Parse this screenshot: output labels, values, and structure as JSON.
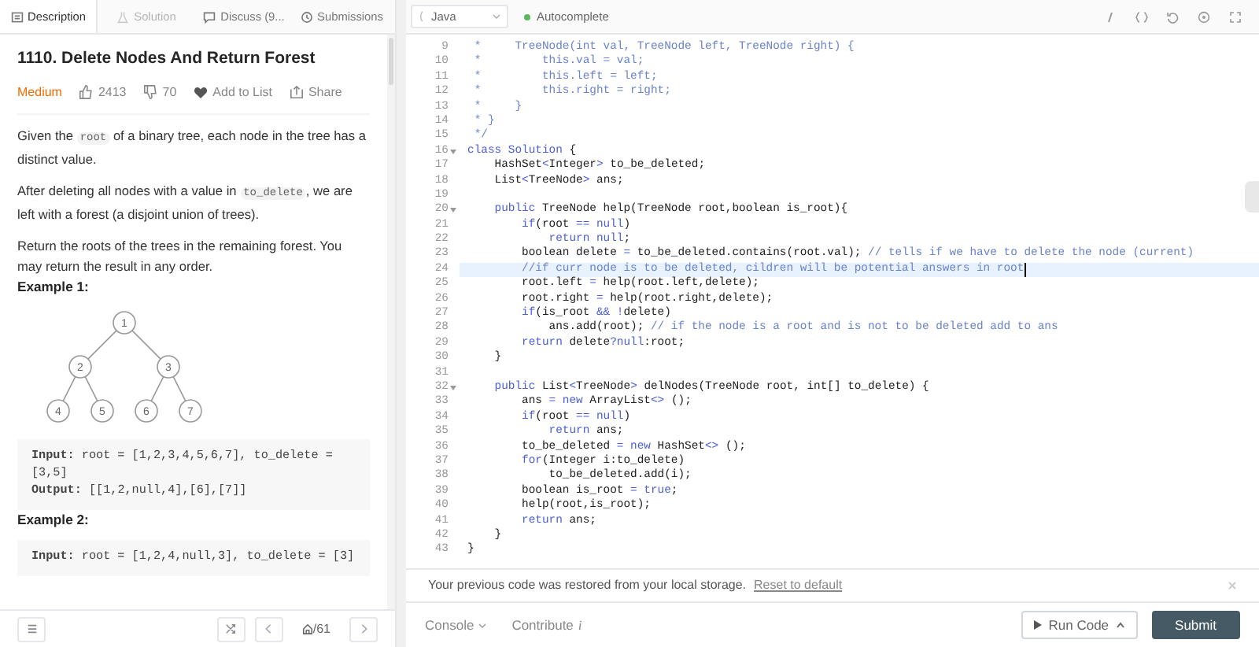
{
  "description_tabs": [
    {
      "label": "Description",
      "selected": true,
      "disabled": false
    },
    {
      "label": "Solution",
      "selected": false,
      "disabled": true
    },
    {
      "label": "Discuss (9...",
      "selected": false,
      "disabled": false
    },
    {
      "label": "Submissions",
      "selected": false,
      "disabled": false
    }
  ],
  "problem": {
    "title": "1110. Delete Nodes And Return Forest",
    "difficulty": "Medium",
    "likes": "2413",
    "dislikes": "70",
    "add_to_list": "Add to List",
    "share": "Share",
    "paragraphs": [
      [
        {
          "text": "Given the ",
          "code": false
        },
        {
          "text": "root",
          "code": true
        },
        {
          "text": " of a binary tree, each node in the tree has a distinct value.",
          "code": false
        }
      ],
      [
        {
          "text": "After deleting all nodes with a value in ",
          "code": false
        },
        {
          "text": "to_delete",
          "code": true
        },
        {
          "text": ", we are left with a forest (a disjoint union of trees).",
          "code": false
        }
      ],
      [
        {
          "text": "Return the roots of the trees in the remaining forest. You may return the result in any order.",
          "code": false
        }
      ]
    ],
    "examples": [
      {
        "title": "Example 1:",
        "tree": {
          "label": "1",
          "children": [
            {
              "label": "2",
              "children": [
                {
                  "label": "4"
                },
                {
                  "label": "5"
                }
              ]
            },
            {
              "label": "3",
              "children": [
                {
                  "label": "6"
                },
                {
                  "label": "7"
                }
              ]
            }
          ]
        },
        "lines": [
          {
            "label": "Input:",
            "text": " root = [1,2,3,4,5,6,7], to_delete = [3,5]"
          },
          {
            "label": "Output:",
            "text": " [[1,2,null,4],[6],[7]]"
          }
        ]
      },
      {
        "title": "Example 2:",
        "lines": [
          {
            "label": "Input:",
            "text": " root = [1,2,4,null,3], to_delete = [3]"
          }
        ]
      }
    ]
  },
  "left_footer": {
    "pager": "/61"
  },
  "editor_toolbar": {
    "language": "Java",
    "autocomplete": {
      "label": "Autocomplete",
      "on": true
    }
  },
  "code_lines": [
    {
      "no": "9",
      "highlighted": false,
      "foldable": false,
      "segments": [
        {
          "kind": "comment",
          "text": " *     TreeNode(int val, TreeNode left, TreeNode right) {"
        }
      ]
    },
    {
      "no": "10",
      "highlighted": false,
      "foldable": false,
      "segments": [
        {
          "kind": "comment",
          "text": " *         this.val = val;"
        }
      ]
    },
    {
      "no": "11",
      "highlighted": false,
      "foldable": false,
      "segments": [
        {
          "kind": "comment",
          "text": " *         this.left = left;"
        }
      ]
    },
    {
      "no": "12",
      "highlighted": false,
      "foldable": false,
      "segments": [
        {
          "kind": "comment",
          "text": " *         this.right = right;"
        }
      ]
    },
    {
      "no": "13",
      "highlighted": false,
      "foldable": false,
      "segments": [
        {
          "kind": "comment",
          "text": " *     }"
        }
      ]
    },
    {
      "no": "14",
      "highlighted": false,
      "foldable": false,
      "segments": [
        {
          "kind": "comment",
          "text": " * }"
        }
      ]
    },
    {
      "no": "15",
      "highlighted": false,
      "foldable": false,
      "segments": [
        {
          "kind": "comment",
          "text": " */"
        }
      ]
    },
    {
      "no": "16",
      "highlighted": false,
      "foldable": true,
      "segments": [
        {
          "kind": "keyword",
          "text": "class Solution"
        },
        {
          "kind": "plain",
          "text": " {"
        }
      ]
    },
    {
      "no": "17",
      "highlighted": false,
      "foldable": false,
      "segments": [
        {
          "kind": "plain",
          "text": "    HashSet"
        },
        {
          "kind": "keyword",
          "text": "<"
        },
        {
          "kind": "plain",
          "text": "Integer"
        },
        {
          "kind": "keyword",
          "text": ">"
        },
        {
          "kind": "plain",
          "text": " to_be_deleted;"
        }
      ]
    },
    {
      "no": "18",
      "highlighted": false,
      "foldable": false,
      "segments": [
        {
          "kind": "plain",
          "text": "    List"
        },
        {
          "kind": "keyword",
          "text": "<"
        },
        {
          "kind": "plain",
          "text": "TreeNode"
        },
        {
          "kind": "keyword",
          "text": ">"
        },
        {
          "kind": "plain",
          "text": " ans;"
        }
      ]
    },
    {
      "no": "19",
      "highlighted": false,
      "foldable": false
    },
    {
      "no": "20",
      "highlighted": false,
      "foldable": true,
      "segments": [
        {
          "kind": "keyword",
          "text": "    public"
        },
        {
          "kind": "plain",
          "text": " TreeNode help(TreeNode root,boolean is_root){"
        }
      ]
    },
    {
      "no": "21",
      "highlighted": false,
      "foldable": false,
      "segments": [
        {
          "kind": "keyword",
          "text": "        if"
        },
        {
          "kind": "plain",
          "text": "(root "
        },
        {
          "kind": "keyword",
          "text": "== null"
        },
        {
          "kind": "plain",
          "text": ")"
        }
      ]
    },
    {
      "no": "22",
      "highlighted": false,
      "foldable": false,
      "segments": [
        {
          "kind": "keyword",
          "text": "            return null"
        },
        {
          "kind": "plain",
          "text": ";"
        }
      ]
    },
    {
      "no": "23",
      "highlighted": false,
      "foldable": false,
      "segments": [
        {
          "kind": "plain",
          "text": "        boolean delete "
        },
        {
          "kind": "keyword",
          "text": "="
        },
        {
          "kind": "plain",
          "text": " to_be_deleted.contains(root.val); "
        },
        {
          "kind": "comment",
          "text": "// tells if we have to delete the node (current)"
        }
      ]
    },
    {
      "no": "24",
      "highlighted": true,
      "foldable": false,
      "segments": [
        {
          "kind": "comment",
          "text": "        //if curr node is to be deleted, cildren will be potential answers in root"
        }
      ]
    },
    {
      "no": "25",
      "highlighted": false,
      "foldable": false,
      "segments": [
        {
          "kind": "plain",
          "text": "        root.left "
        },
        {
          "kind": "keyword",
          "text": "="
        },
        {
          "kind": "plain",
          "text": " help(root.left,delete);"
        }
      ]
    },
    {
      "no": "26",
      "highlighted": false,
      "foldable": false,
      "segments": [
        {
          "kind": "plain",
          "text": "        root.right "
        },
        {
          "kind": "keyword",
          "text": "="
        },
        {
          "kind": "plain",
          "text": " help(root.right,delete);"
        }
      ]
    },
    {
      "no": "27",
      "highlighted": false,
      "foldable": false,
      "segments": [
        {
          "kind": "keyword",
          "text": "        if"
        },
        {
          "kind": "plain",
          "text": "(is_root "
        },
        {
          "kind": "keyword",
          "text": "&& !"
        },
        {
          "kind": "plain",
          "text": "delete)"
        }
      ]
    },
    {
      "no": "28",
      "highlighted": false,
      "foldable": false,
      "segments": [
        {
          "kind": "plain",
          "text": "            ans.add(root); "
        },
        {
          "kind": "comment",
          "text": "// if the node is a root and is not to be deleted add to ans"
        }
      ]
    },
    {
      "no": "29",
      "highlighted": false,
      "foldable": false,
      "segments": [
        {
          "kind": "keyword",
          "text": "        return"
        },
        {
          "kind": "plain",
          "text": " delete"
        },
        {
          "kind": "keyword",
          "text": "?null"
        },
        {
          "kind": "plain",
          "text": ":root;"
        }
      ]
    },
    {
      "no": "30",
      "highlighted": false,
      "foldable": false,
      "segments": [
        {
          "kind": "plain",
          "text": "    }"
        }
      ]
    },
    {
      "no": "31",
      "highlighted": false,
      "foldable": false
    },
    {
      "no": "32",
      "highlighted": false,
      "foldable": true,
      "segments": [
        {
          "kind": "keyword",
          "text": "    public"
        },
        {
          "kind": "plain",
          "text": " List"
        },
        {
          "kind": "keyword",
          "text": "<"
        },
        {
          "kind": "plain",
          "text": "TreeNode"
        },
        {
          "kind": "keyword",
          "text": ">"
        },
        {
          "kind": "plain",
          "text": " delNodes(TreeNode root, int[] to_delete) {"
        }
      ]
    },
    {
      "no": "33",
      "highlighted": false,
      "foldable": false,
      "segments": [
        {
          "kind": "plain",
          "text": "        ans "
        },
        {
          "kind": "keyword",
          "text": "= new"
        },
        {
          "kind": "plain",
          "text": " ArrayList"
        },
        {
          "kind": "keyword",
          "text": "<>"
        },
        {
          "kind": "plain",
          "text": " ();"
        }
      ]
    },
    {
      "no": "34",
      "highlighted": false,
      "foldable": false,
      "segments": [
        {
          "kind": "keyword",
          "text": "        if"
        },
        {
          "kind": "plain",
          "text": "(root "
        },
        {
          "kind": "keyword",
          "text": "== null"
        },
        {
          "kind": "plain",
          "text": ")"
        }
      ]
    },
    {
      "no": "35",
      "highlighted": false,
      "foldable": false,
      "segments": [
        {
          "kind": "keyword",
          "text": "            return"
        },
        {
          "kind": "plain",
          "text": " ans;"
        }
      ]
    },
    {
      "no": "36",
      "highlighted": false,
      "foldable": false,
      "segments": [
        {
          "kind": "plain",
          "text": "        to_be_deleted "
        },
        {
          "kind": "keyword",
          "text": "= new"
        },
        {
          "kind": "plain",
          "text": " HashSet"
        },
        {
          "kind": "keyword",
          "text": "<>"
        },
        {
          "kind": "plain",
          "text": " ();"
        }
      ]
    },
    {
      "no": "37",
      "highlighted": false,
      "foldable": false,
      "segments": [
        {
          "kind": "keyword",
          "text": "        for"
        },
        {
          "kind": "plain",
          "text": "(Integer i:to_delete)"
        }
      ]
    },
    {
      "no": "38",
      "highlighted": false,
      "foldable": false,
      "segments": [
        {
          "kind": "plain",
          "text": "            to_be_deleted.add(i);"
        }
      ]
    },
    {
      "no": "39",
      "highlighted": false,
      "foldable": false,
      "segments": [
        {
          "kind": "plain",
          "text": "        boolean is_root "
        },
        {
          "kind": "keyword",
          "text": "= true"
        },
        {
          "kind": "plain",
          "text": ";"
        }
      ]
    },
    {
      "no": "40",
      "highlighted": false,
      "foldable": false,
      "segments": [
        {
          "kind": "plain",
          "text": "        help(root,is_root);"
        }
      ]
    },
    {
      "no": "41",
      "highlighted": false,
      "foldable": false,
      "segments": [
        {
          "kind": "keyword",
          "text": "        return"
        },
        {
          "kind": "plain",
          "text": " ans;"
        }
      ]
    },
    {
      "no": "42",
      "highlighted": false,
      "foldable": false,
      "segments": [
        {
          "kind": "plain",
          "text": "    }"
        }
      ]
    },
    {
      "no": "43",
      "highlighted": false,
      "foldable": false,
      "segments": [
        {
          "kind": "plain",
          "text": "}"
        }
      ]
    }
  ],
  "notice": {
    "text": "Your previous code was restored from your local storage.",
    "link": "Reset to default"
  },
  "editor_footer": {
    "console": "Console",
    "contribute": "Contribute",
    "contribute_icon": "i",
    "run": "Run Code",
    "submit": "Submit"
  }
}
